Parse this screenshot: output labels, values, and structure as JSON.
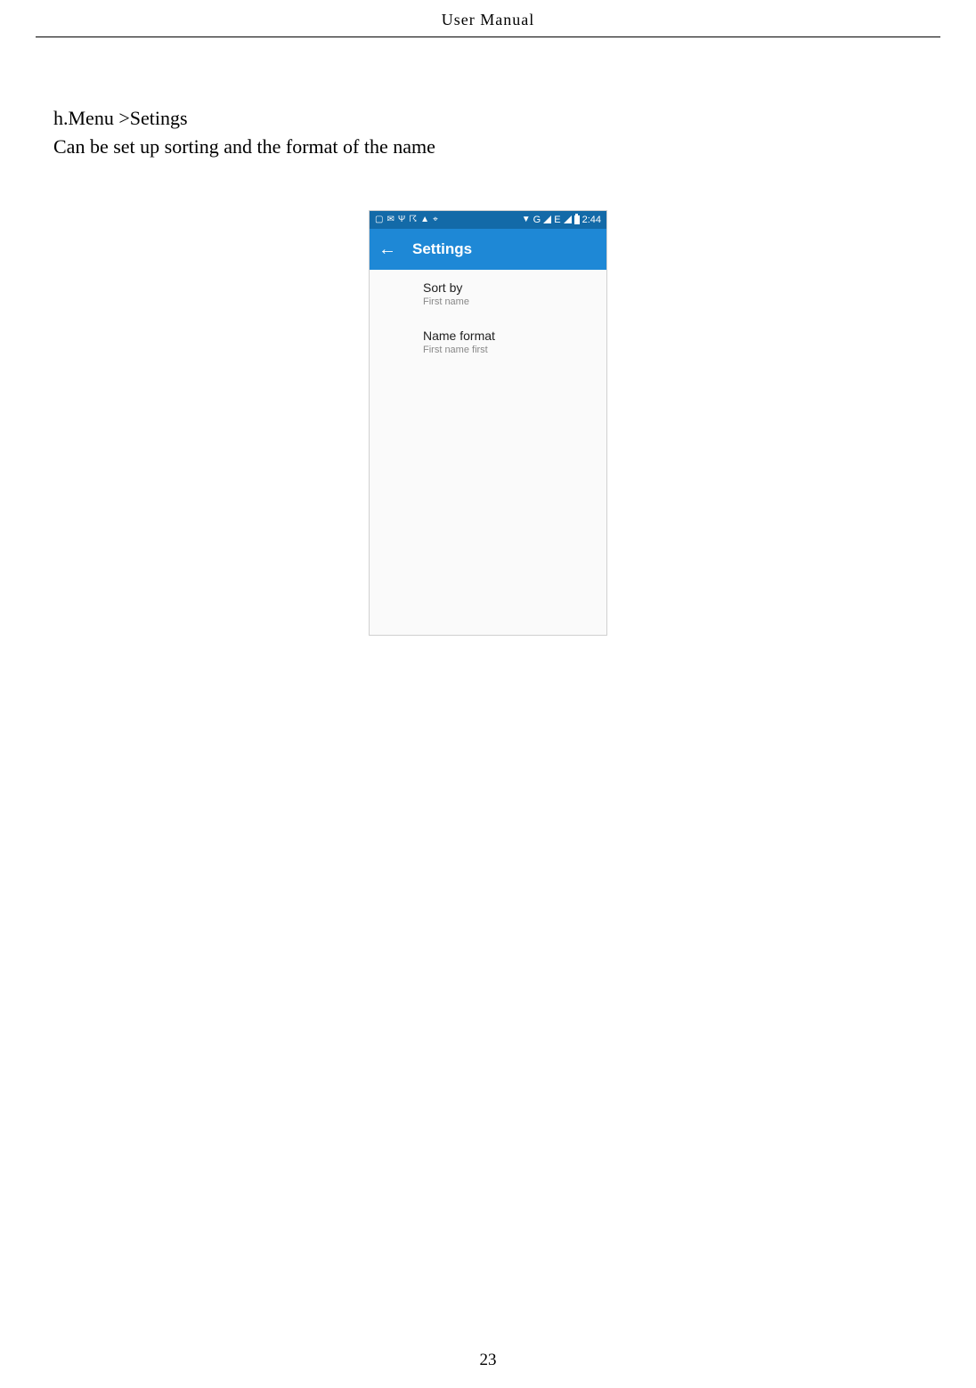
{
  "header": {
    "title": "User    Manual"
  },
  "body": {
    "line1": "h.Menu >Setings",
    "line2": "Can be set up sorting and the format of the name"
  },
  "phone": {
    "status": {
      "time": "2:44",
      "net1": "G",
      "net2": "E"
    },
    "appbar": {
      "title": "Settings"
    },
    "items": [
      {
        "title": "Sort by",
        "sub": "First name"
      },
      {
        "title": "Name format",
        "sub": "First name first"
      }
    ]
  },
  "footer": {
    "page_number": "23"
  }
}
